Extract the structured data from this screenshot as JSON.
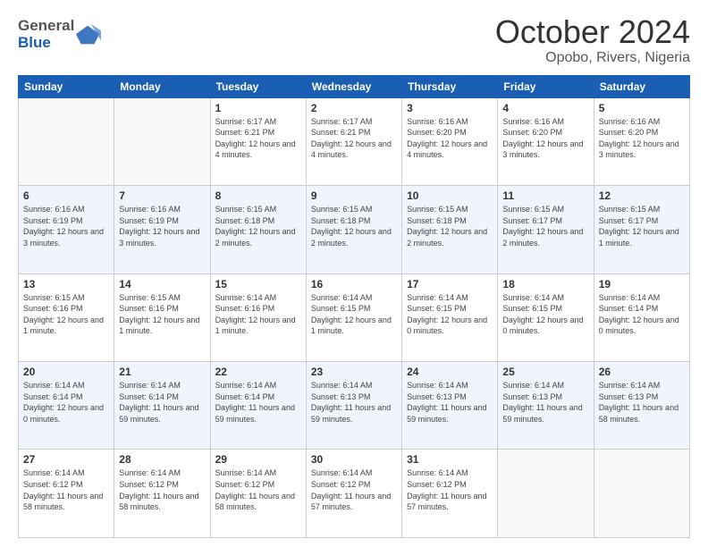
{
  "header": {
    "logo_line1": "General",
    "logo_line2": "Blue",
    "title": "October 2024",
    "subtitle": "Opobo, Rivers, Nigeria"
  },
  "columns": [
    "Sunday",
    "Monday",
    "Tuesday",
    "Wednesday",
    "Thursday",
    "Friday",
    "Saturday"
  ],
  "weeks": [
    [
      {
        "day": "",
        "sunrise": "",
        "sunset": "",
        "daylight": ""
      },
      {
        "day": "",
        "sunrise": "",
        "sunset": "",
        "daylight": ""
      },
      {
        "day": "1",
        "sunrise": "Sunrise: 6:17 AM",
        "sunset": "Sunset: 6:21 PM",
        "daylight": "Daylight: 12 hours and 4 minutes."
      },
      {
        "day": "2",
        "sunrise": "Sunrise: 6:17 AM",
        "sunset": "Sunset: 6:21 PM",
        "daylight": "Daylight: 12 hours and 4 minutes."
      },
      {
        "day": "3",
        "sunrise": "Sunrise: 6:16 AM",
        "sunset": "Sunset: 6:20 PM",
        "daylight": "Daylight: 12 hours and 4 minutes."
      },
      {
        "day": "4",
        "sunrise": "Sunrise: 6:16 AM",
        "sunset": "Sunset: 6:20 PM",
        "daylight": "Daylight: 12 hours and 3 minutes."
      },
      {
        "day": "5",
        "sunrise": "Sunrise: 6:16 AM",
        "sunset": "Sunset: 6:20 PM",
        "daylight": "Daylight: 12 hours and 3 minutes."
      }
    ],
    [
      {
        "day": "6",
        "sunrise": "Sunrise: 6:16 AM",
        "sunset": "Sunset: 6:19 PM",
        "daylight": "Daylight: 12 hours and 3 minutes."
      },
      {
        "day": "7",
        "sunrise": "Sunrise: 6:16 AM",
        "sunset": "Sunset: 6:19 PM",
        "daylight": "Daylight: 12 hours and 3 minutes."
      },
      {
        "day": "8",
        "sunrise": "Sunrise: 6:15 AM",
        "sunset": "Sunset: 6:18 PM",
        "daylight": "Daylight: 12 hours and 2 minutes."
      },
      {
        "day": "9",
        "sunrise": "Sunrise: 6:15 AM",
        "sunset": "Sunset: 6:18 PM",
        "daylight": "Daylight: 12 hours and 2 minutes."
      },
      {
        "day": "10",
        "sunrise": "Sunrise: 6:15 AM",
        "sunset": "Sunset: 6:18 PM",
        "daylight": "Daylight: 12 hours and 2 minutes."
      },
      {
        "day": "11",
        "sunrise": "Sunrise: 6:15 AM",
        "sunset": "Sunset: 6:17 PM",
        "daylight": "Daylight: 12 hours and 2 minutes."
      },
      {
        "day": "12",
        "sunrise": "Sunrise: 6:15 AM",
        "sunset": "Sunset: 6:17 PM",
        "daylight": "Daylight: 12 hours and 1 minute."
      }
    ],
    [
      {
        "day": "13",
        "sunrise": "Sunrise: 6:15 AM",
        "sunset": "Sunset: 6:16 PM",
        "daylight": "Daylight: 12 hours and 1 minute."
      },
      {
        "day": "14",
        "sunrise": "Sunrise: 6:15 AM",
        "sunset": "Sunset: 6:16 PM",
        "daylight": "Daylight: 12 hours and 1 minute."
      },
      {
        "day": "15",
        "sunrise": "Sunrise: 6:14 AM",
        "sunset": "Sunset: 6:16 PM",
        "daylight": "Daylight: 12 hours and 1 minute."
      },
      {
        "day": "16",
        "sunrise": "Sunrise: 6:14 AM",
        "sunset": "Sunset: 6:15 PM",
        "daylight": "Daylight: 12 hours and 1 minute."
      },
      {
        "day": "17",
        "sunrise": "Sunrise: 6:14 AM",
        "sunset": "Sunset: 6:15 PM",
        "daylight": "Daylight: 12 hours and 0 minutes."
      },
      {
        "day": "18",
        "sunrise": "Sunrise: 6:14 AM",
        "sunset": "Sunset: 6:15 PM",
        "daylight": "Daylight: 12 hours and 0 minutes."
      },
      {
        "day": "19",
        "sunrise": "Sunrise: 6:14 AM",
        "sunset": "Sunset: 6:14 PM",
        "daylight": "Daylight: 12 hours and 0 minutes."
      }
    ],
    [
      {
        "day": "20",
        "sunrise": "Sunrise: 6:14 AM",
        "sunset": "Sunset: 6:14 PM",
        "daylight": "Daylight: 12 hours and 0 minutes."
      },
      {
        "day": "21",
        "sunrise": "Sunrise: 6:14 AM",
        "sunset": "Sunset: 6:14 PM",
        "daylight": "Daylight: 11 hours and 59 minutes."
      },
      {
        "day": "22",
        "sunrise": "Sunrise: 6:14 AM",
        "sunset": "Sunset: 6:14 PM",
        "daylight": "Daylight: 11 hours and 59 minutes."
      },
      {
        "day": "23",
        "sunrise": "Sunrise: 6:14 AM",
        "sunset": "Sunset: 6:13 PM",
        "daylight": "Daylight: 11 hours and 59 minutes."
      },
      {
        "day": "24",
        "sunrise": "Sunrise: 6:14 AM",
        "sunset": "Sunset: 6:13 PM",
        "daylight": "Daylight: 11 hours and 59 minutes."
      },
      {
        "day": "25",
        "sunrise": "Sunrise: 6:14 AM",
        "sunset": "Sunset: 6:13 PM",
        "daylight": "Daylight: 11 hours and 59 minutes."
      },
      {
        "day": "26",
        "sunrise": "Sunrise: 6:14 AM",
        "sunset": "Sunset: 6:13 PM",
        "daylight": "Daylight: 11 hours and 58 minutes."
      }
    ],
    [
      {
        "day": "27",
        "sunrise": "Sunrise: 6:14 AM",
        "sunset": "Sunset: 6:12 PM",
        "daylight": "Daylight: 11 hours and 58 minutes."
      },
      {
        "day": "28",
        "sunrise": "Sunrise: 6:14 AM",
        "sunset": "Sunset: 6:12 PM",
        "daylight": "Daylight: 11 hours and 58 minutes."
      },
      {
        "day": "29",
        "sunrise": "Sunrise: 6:14 AM",
        "sunset": "Sunset: 6:12 PM",
        "daylight": "Daylight: 11 hours and 58 minutes."
      },
      {
        "day": "30",
        "sunrise": "Sunrise: 6:14 AM",
        "sunset": "Sunset: 6:12 PM",
        "daylight": "Daylight: 11 hours and 57 minutes."
      },
      {
        "day": "31",
        "sunrise": "Sunrise: 6:14 AM",
        "sunset": "Sunset: 6:12 PM",
        "daylight": "Daylight: 11 hours and 57 minutes."
      },
      {
        "day": "",
        "sunrise": "",
        "sunset": "",
        "daylight": ""
      },
      {
        "day": "",
        "sunrise": "",
        "sunset": "",
        "daylight": ""
      }
    ]
  ]
}
